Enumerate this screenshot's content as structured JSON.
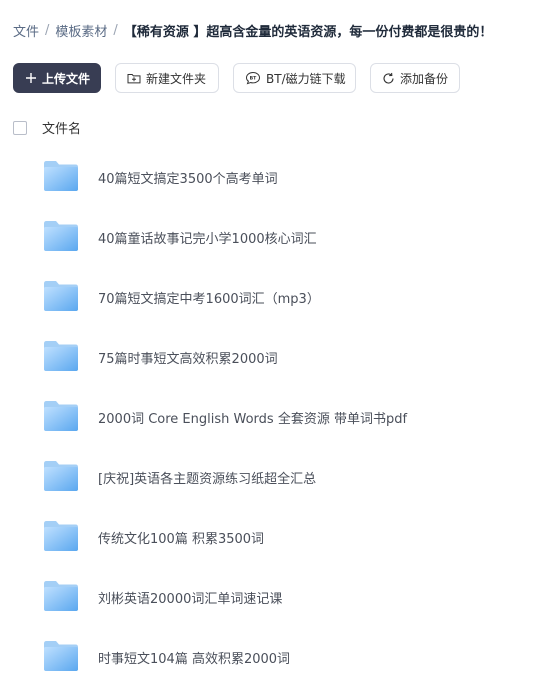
{
  "breadcrumb": {
    "items": [
      "文件",
      "模板素材"
    ],
    "separator": "/",
    "current": "【稀有资源 】超高含金量的英语资源，每一份付费都是很贵的！"
  },
  "toolbar": {
    "upload_label": "上传文件",
    "new_folder_label": "新建文件夹",
    "bt_label": "BT/磁力链下载",
    "backup_label": "添加备份"
  },
  "list_header": {
    "name_label": "文件名"
  },
  "files": [
    {
      "name": "40篇短文搞定3500个高考单词"
    },
    {
      "name": "40篇童话故事记完小学1000核心词汇"
    },
    {
      "name": "70篇短文搞定中考1600词汇（mp3）"
    },
    {
      "name": "75篇时事短文高效积累2000词"
    },
    {
      "name": "2000词 Core English Words 全套资源 带单词书pdf"
    },
    {
      "name": "[庆祝]英语各主题资源练习纸超全汇总"
    },
    {
      "name": "传统文化100篇 积累3500词"
    },
    {
      "name": "刘彬英语20000词汇单词速记课"
    },
    {
      "name": "时事短文104篇 高效积累2000词"
    }
  ],
  "colors": {
    "primary_button": "#383d53",
    "folder_light": "#bfe0ff",
    "folder_dark": "#5aa7ef"
  }
}
